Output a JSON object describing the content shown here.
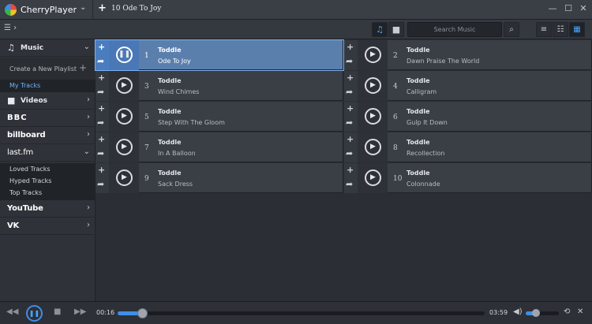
{
  "app": {
    "name": "CherryPlayer",
    "tab_title": "10 Ode To Joy"
  },
  "search": {
    "placeholder": "Search Music"
  },
  "sidebar": {
    "music_label": "Music",
    "create_playlist": "Create a New Playlist",
    "my_tracks": "My Tracks",
    "videos_label": "Videos",
    "bbc": "BBC",
    "billboard": "billboard",
    "lastfm": "last.fm",
    "lastfm_items": [
      "Loved Tracks",
      "Hyped Tracks",
      "Top Tracks"
    ],
    "youtube": "YouTube",
    "vk": "VK"
  },
  "tracks": [
    {
      "num": "1",
      "artist": "Toddle",
      "title": "Ode To Joy",
      "playing": true
    },
    {
      "num": "2",
      "artist": "Toddle",
      "title": "Dawn Praise The World",
      "playing": false
    },
    {
      "num": "3",
      "artist": "Toddle",
      "title": "Wind Chimes",
      "playing": false
    },
    {
      "num": "4",
      "artist": "Toddle",
      "title": "Calligram",
      "playing": false
    },
    {
      "num": "5",
      "artist": "Toddle",
      "title": "Step With The Gloom",
      "playing": false
    },
    {
      "num": "6",
      "artist": "Toddle",
      "title": "Gulp It Down",
      "playing": false
    },
    {
      "num": "7",
      "artist": "Toddle",
      "title": "In A Balloon",
      "playing": false
    },
    {
      "num": "8",
      "artist": "Toddle",
      "title": "Recollection",
      "playing": false
    },
    {
      "num": "9",
      "artist": "Toddle",
      "title": "Sack Dress",
      "playing": false
    },
    {
      "num": "10",
      "artist": "Toddle",
      "title": "Colonnade",
      "playing": false
    }
  ],
  "player": {
    "elapsed": "00:16",
    "total": "03:59",
    "progress": 0.067,
    "volume": 0.3
  },
  "colors": {
    "accent": "#3f8ee8",
    "active_tile": "#5b7fad"
  }
}
